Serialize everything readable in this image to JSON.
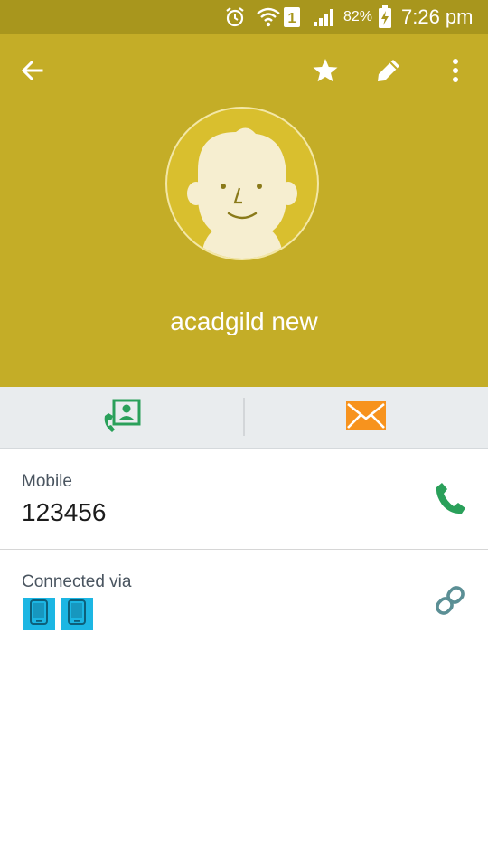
{
  "status_bar": {
    "battery": "82%",
    "time": "7:26 pm",
    "sim_number": "1",
    "icons": [
      "alarm-icon",
      "wifi-icon",
      "sim-icon",
      "signal-icon",
      "battery-charging-icon"
    ]
  },
  "header": {
    "background": "#c4ad27",
    "icons": [
      "back-arrow-icon",
      "star-icon",
      "edit-pencil-icon",
      "more-vert-icon"
    ]
  },
  "contact": {
    "name": "acadgild new",
    "avatar_icon": "default-avatar-icon"
  },
  "actions": [
    {
      "name": "call-contact",
      "icon": "phone-contact-icon",
      "color": "#2aa05a"
    },
    {
      "name": "message",
      "icon": "envelope-icon",
      "color": "#f7931e"
    }
  ],
  "phone": {
    "label": "Mobile",
    "number": "123456",
    "icon": "phone-icon"
  },
  "connected": {
    "label": "Connected via",
    "devices": [
      "device-icon",
      "device-icon"
    ],
    "link_icon": "link-icon"
  },
  "colors": {
    "statusbar": "#a8961d",
    "accent_green": "#2aa05a",
    "accent_orange": "#f7931e",
    "device_blue": "#1cb6e3"
  }
}
